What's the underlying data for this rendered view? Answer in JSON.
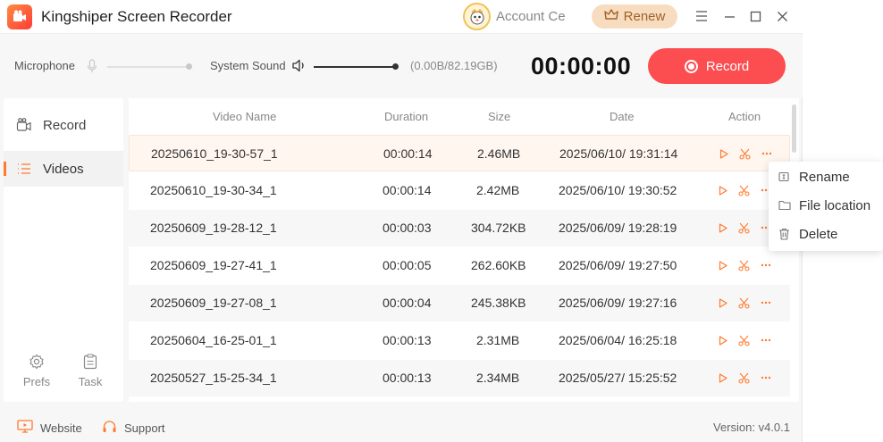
{
  "titlebar": {
    "app_title": "Kingshiper Screen Recorder",
    "account_label": "Account Ce",
    "renew_label": "Renew",
    "icons": [
      "app-logo-icon",
      "crown-icon",
      "menu-icon",
      "minimize-icon",
      "maximize-icon",
      "close-icon"
    ]
  },
  "toolbar": {
    "microphone_label": "Microphone",
    "system_sound_label": "System Sound",
    "microphone_level": 0,
    "system_sound_level": 1,
    "storage": "(0.00B/82.19GB)",
    "timer": "00:00:00",
    "record_label": "Record"
  },
  "sidebar": {
    "items": [
      {
        "label": "Record",
        "icon": "record-camera-icon",
        "active": false
      },
      {
        "label": "Videos",
        "icon": "list-icon",
        "active": true
      }
    ],
    "prefs_label": "Prefs",
    "task_label": "Task"
  },
  "table": {
    "headers": [
      "Video Name",
      "Duration",
      "Size",
      "Date",
      "Action"
    ],
    "rows": [
      {
        "name": "20250610_19-30-57_1",
        "duration": "00:00:14",
        "size": "2.46MB",
        "date": "2025/06/10/ 19:31:14"
      },
      {
        "name": "20250610_19-30-34_1",
        "duration": "00:00:14",
        "size": "2.42MB",
        "date": "2025/06/10/ 19:30:52"
      },
      {
        "name": "20250609_19-28-12_1",
        "duration": "00:00:03",
        "size": "304.72KB",
        "date": "2025/06/09/ 19:28:19"
      },
      {
        "name": "20250609_19-27-41_1",
        "duration": "00:00:05",
        "size": "262.60KB",
        "date": "2025/06/09/ 19:27:50"
      },
      {
        "name": "20250609_19-27-08_1",
        "duration": "00:00:04",
        "size": "245.38KB",
        "date": "2025/06/09/ 19:27:16"
      },
      {
        "name": "20250604_16-25-01_1",
        "duration": "00:00:13",
        "size": "2.31MB",
        "date": "2025/06/04/ 16:25:18"
      },
      {
        "name": "20250527_15-25-34_1",
        "duration": "00:00:13",
        "size": "2.34MB",
        "date": "2025/05/27/ 15:25:52"
      }
    ],
    "action_icons": [
      "play-icon",
      "scissors-icon",
      "more-icon"
    ]
  },
  "context_menu": {
    "items": [
      {
        "label": "Rename",
        "icon": "rename-icon"
      },
      {
        "label": "File location",
        "icon": "folder-icon"
      },
      {
        "label": "Delete",
        "icon": "trash-icon"
      }
    ]
  },
  "footer": {
    "website_label": "Website",
    "support_label": "Support",
    "version": "Version: v4.0.1"
  },
  "colors": {
    "accent": "#ff7a2f",
    "record": "#fc4d51",
    "renew_bg": "#f8dcc0",
    "selected_row": "#fff6ef"
  }
}
